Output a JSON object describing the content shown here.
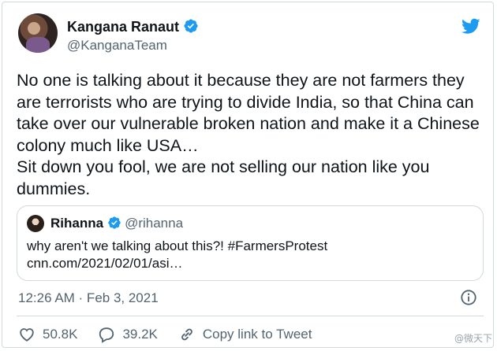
{
  "tweet": {
    "author_name": "Kangana Ranaut",
    "author_handle": "@KanganaTeam",
    "lines": [
      "No one is talking about it because they are not farmers they",
      "are terrorists who are trying to divide India, so that China can",
      "take over our vulnerable broken nation and make it a Chinese",
      "colony much like USA…",
      "Sit down you fool, we are not selling our nation like you",
      "dummies."
    ],
    "timestamp": "12:26 AM · Feb 3, 2021"
  },
  "quote": {
    "name": "Rihanna",
    "handle": "@rihanna",
    "text": "why aren't we talking about this?! #FarmersProtest",
    "link": "cnn.com/2021/02/01/asi…"
  },
  "actions": {
    "likes": "50.8K",
    "replies": "39.2K",
    "copy_link": "Copy link to Tweet"
  },
  "watermark": "@微天下",
  "icons": {
    "verified": "verified-badge-icon",
    "brand": "twitter-bird-icon",
    "info": "info-icon",
    "like": "heart-icon",
    "reply": "reply-icon",
    "link": "link-icon"
  },
  "colors": {
    "twitter_blue": "#1d9bf0",
    "text_primary": "#0f1419",
    "text_secondary": "#536471",
    "border": "#cfd9de"
  }
}
